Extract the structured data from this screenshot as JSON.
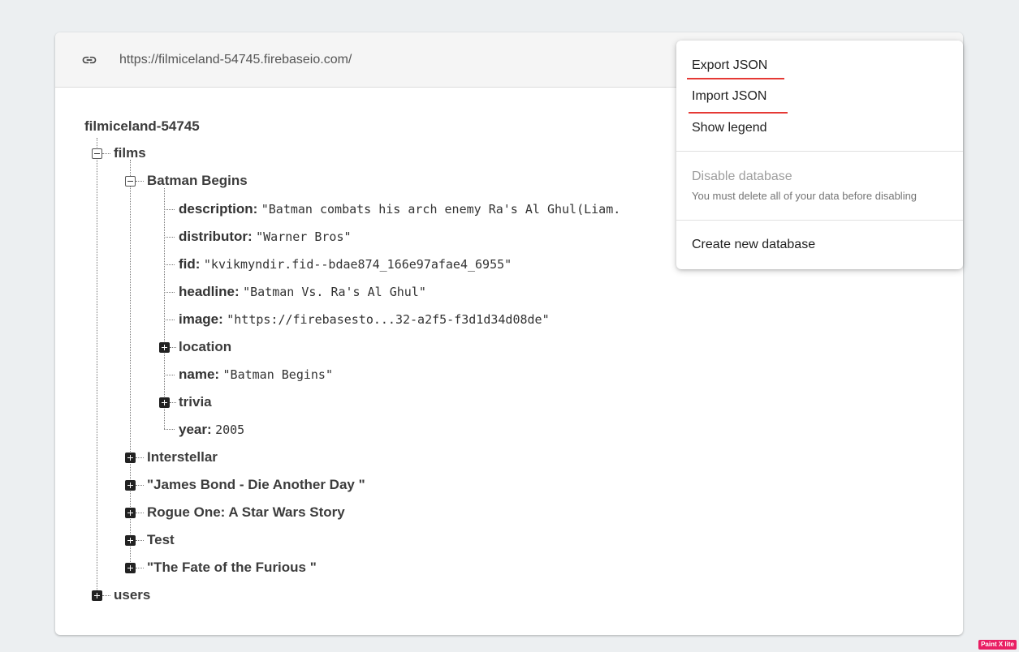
{
  "header": {
    "url": "https://filmiceland-54745.firebaseio.com/"
  },
  "tree": {
    "root": "filmiceland-54745",
    "films_label": "films",
    "batman_label": "Batman Begins",
    "fields": [
      {
        "key": "description:",
        "value": "\"Batman combats his arch enemy Ra's Al Ghul(Liam."
      },
      {
        "key": "distributor:",
        "value": "\"Warner Bros\""
      },
      {
        "key": "fid:",
        "value": "\"kvikmyndir.fid--bdae874_166e97afae4_6955\""
      },
      {
        "key": "headline:",
        "value": "\"Batman Vs. Ra's Al Ghul\""
      },
      {
        "key": "image:",
        "value": "\"https://firebasesto...32-a2f5-f3d1d34d08de\""
      }
    ],
    "location_label": "location",
    "name_field": {
      "key": "name:",
      "value": "\"Batman Begins\""
    },
    "trivia_label": "trivia",
    "year_field": {
      "key": "year:",
      "value": "2005"
    },
    "other_films": [
      "Interstellar",
      "\"James Bond - Die Another Day \"",
      "Rogue One: A Star Wars Story",
      "Test",
      "\"The Fate of the Furious \""
    ],
    "users_label": "users"
  },
  "menu": {
    "export_json": "Export JSON",
    "import_json": "Import JSON",
    "show_legend": "Show legend",
    "disable_database": "Disable database",
    "disable_hint": "You must delete all of your data before disabling",
    "create_new_database": "Create new database"
  },
  "watermark": "Paint X lite",
  "colors": {
    "underline": "#e53935",
    "background": "#eceff1"
  }
}
